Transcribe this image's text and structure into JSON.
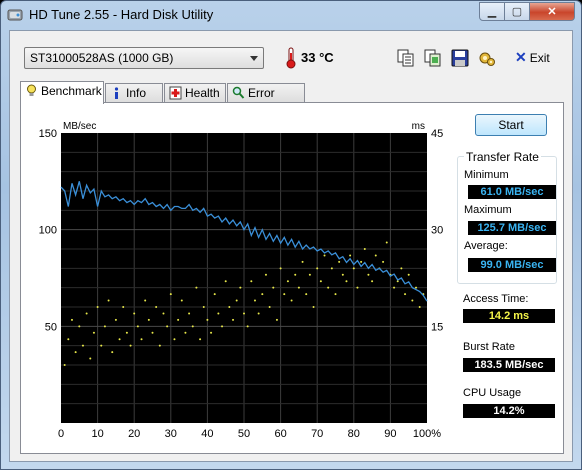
{
  "window": {
    "title": "HD Tune 2.55 - Hard Disk Utility"
  },
  "toolbar": {
    "drive": "ST31000528AS (1000 GB)",
    "temperature": "33 °C",
    "exit_label": "Exit",
    "icons": [
      "copy-text-icon",
      "copy-screenshot-icon",
      "save-icon",
      "options-icon"
    ]
  },
  "tabs": [
    {
      "label": "Benchmark",
      "icon": "lightbulb-icon",
      "active": true
    },
    {
      "label": "Info",
      "icon": "info-icon",
      "active": false
    },
    {
      "label": "Health",
      "icon": "health-cross-icon",
      "active": false
    },
    {
      "label": "Error Scan",
      "icon": "magnifier-icon",
      "active": false
    }
  ],
  "benchmark": {
    "start_label": "Start",
    "transfer_rate_title": "Transfer Rate",
    "minimum_label": "Minimum",
    "minimum_value": "61.0 MB/sec",
    "maximum_label": "Maximum",
    "maximum_value": "125.7 MB/sec",
    "average_label": "Average:",
    "average_value": "99.0 MB/sec",
    "access_time_label": "Access Time:",
    "access_time_value": "14.2 ms",
    "burst_rate_label": "Burst Rate",
    "burst_rate_value": "183.5 MB/sec",
    "cpu_usage_label": "CPU Usage",
    "cpu_usage_value": "14.2%"
  },
  "chart_data": {
    "type": "line",
    "ylabel_left": "MB/sec",
    "ylabel_right": "ms",
    "y_left_range": [
      0,
      150
    ],
    "y_right_range": [
      0,
      45
    ],
    "x_range": [
      0,
      100
    ],
    "y_left_ticks": [
      "150",
      "100",
      "50"
    ],
    "y_right_ticks": [
      "45",
      "30",
      "15"
    ],
    "x_ticks": [
      "0",
      "10",
      "20",
      "30",
      "40",
      "50",
      "60",
      "70",
      "80",
      "90",
      "100%"
    ],
    "grid": true,
    "series": [
      {
        "color": "#3a8fd8",
        "x": [
          0,
          1,
          2,
          3,
          4,
          5,
          6,
          7,
          8,
          9,
          10,
          11,
          12,
          13,
          14,
          15,
          16,
          17,
          18,
          19,
          20,
          21,
          22,
          23,
          24,
          25,
          26,
          27,
          28,
          29,
          30,
          31,
          32,
          33,
          34,
          35,
          36,
          37,
          38,
          39,
          40,
          41,
          42,
          43,
          44,
          45,
          46,
          47,
          48,
          49,
          50,
          51,
          52,
          53,
          54,
          55,
          56,
          57,
          58,
          59,
          60,
          61,
          62,
          63,
          64,
          65,
          66,
          67,
          68,
          69,
          70,
          71,
          72,
          73,
          74,
          75,
          76,
          77,
          78,
          79,
          80,
          81,
          82,
          83,
          84,
          85,
          86,
          87,
          88,
          89,
          90,
          91,
          92,
          93,
          94,
          95,
          96,
          97,
          98,
          99,
          100
        ],
        "values": [
          122,
          120,
          112,
          124,
          118,
          125,
          116,
          123,
          119,
          121,
          112,
          120,
          117,
          118,
          116,
          117,
          115,
          116,
          114,
          115,
          113,
          115,
          114,
          116,
          113,
          114,
          112,
          113,
          111,
          113,
          110,
          112,
          112,
          111,
          111,
          113,
          110,
          111,
          109,
          111,
          107,
          108,
          106,
          107,
          104,
          106,
          103,
          105,
          102,
          104,
          100,
          103,
          97,
          101,
          96,
          100,
          95,
          98,
          94,
          97,
          93,
          96,
          92,
          95,
          91,
          94,
          90,
          92,
          90,
          91,
          89,
          90,
          88,
          89,
          87,
          88,
          85,
          86,
          83,
          85,
          82,
          84,
          81,
          83,
          80,
          82,
          79,
          80,
          78,
          79,
          76,
          77,
          74,
          75,
          72,
          73,
          70,
          69,
          68,
          66,
          63
        ]
      }
    ],
    "access_time_points": {
      "color": "#e8e84a",
      "unit": "ms",
      "x": [
        1,
        2,
        3,
        4,
        5,
        6,
        7,
        8,
        9,
        10,
        11,
        12,
        13,
        14,
        15,
        16,
        17,
        18,
        19,
        20,
        21,
        22,
        23,
        24,
        25,
        26,
        27,
        28,
        29,
        30,
        31,
        32,
        33,
        34,
        35,
        36,
        37,
        38,
        39,
        40,
        41,
        42,
        43,
        44,
        45,
        46,
        47,
        48,
        49,
        50,
        51,
        52,
        53,
        54,
        55,
        56,
        57,
        58,
        59,
        60,
        61,
        62,
        63,
        64,
        65,
        66,
        67,
        68,
        69,
        70,
        71,
        72,
        73,
        74,
        75,
        76,
        77,
        78,
        79,
        80,
        81,
        82,
        83,
        84,
        85,
        86,
        87,
        88,
        89,
        90,
        91,
        92,
        93,
        94,
        95,
        96,
        97,
        98,
        99
      ],
      "values": [
        9,
        13,
        16,
        11,
        15,
        12,
        17,
        10,
        14,
        18,
        12,
        15,
        19,
        11,
        16,
        13,
        18,
        14,
        12,
        17,
        15,
        13,
        19,
        16,
        14,
        18,
        12,
        17,
        15,
        20,
        13,
        16,
        19,
        14,
        17,
        15,
        21,
        13,
        18,
        16,
        14,
        20,
        17,
        15,
        22,
        18,
        16,
        19,
        21,
        17,
        15,
        22,
        19,
        17,
        20,
        23,
        18,
        21,
        16,
        24,
        20,
        22,
        19,
        23,
        21,
        25,
        20,
        23,
        18,
        24,
        22,
        26,
        21,
        24,
        20,
        25,
        23,
        22,
        26,
        24,
        21,
        25,
        27,
        23,
        22,
        26,
        24,
        25,
        28,
        23,
        21,
        22,
        24,
        20,
        23,
        19,
        21,
        18,
        20
      ]
    }
  }
}
